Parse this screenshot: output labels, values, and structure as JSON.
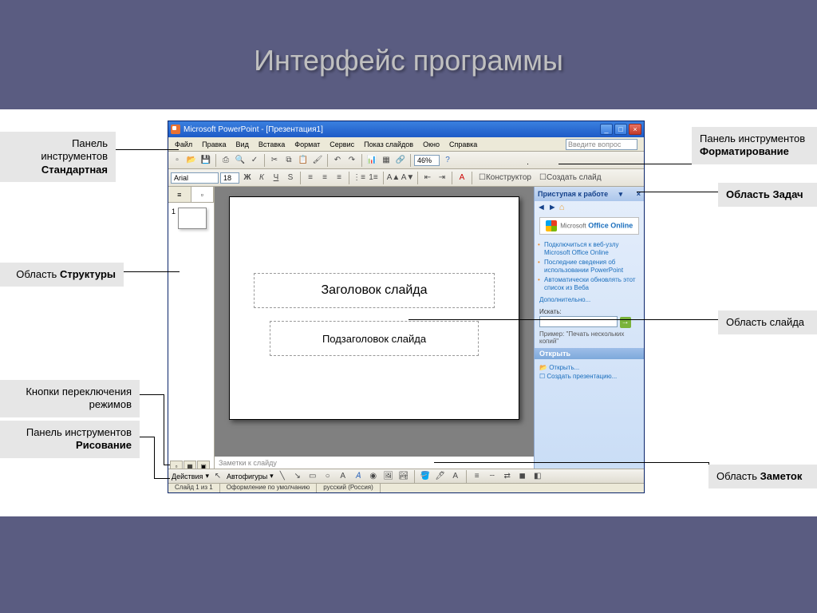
{
  "page_title": "Интерфейс программы",
  "callouts": {
    "standard_toolbar": "Панель инструментов",
    "standard_toolbar_b": "Стандартная",
    "format_toolbar": "Панель инструментов",
    "format_toolbar_b": "Форматирование",
    "task_area": "Область ",
    "task_area_b": "Задач",
    "outline_area": "Область ",
    "outline_area_b": "Структуры",
    "slide_area": "Область слайда",
    "view_btns": "Кнопки переключения режимов",
    "draw_toolbar": "Панель инструментов",
    "draw_toolbar_b": "Рисование",
    "notes_area": "Область ",
    "notes_area_b": "Заметок"
  },
  "app": {
    "title": "Microsoft PowerPoint  - [Презентация1]",
    "menus": [
      "Файл",
      "Правка",
      "Вид",
      "Вставка",
      "Формат",
      "Сервис",
      "Показ слайдов",
      "Окно",
      "Справка"
    ],
    "ask_placeholder": "Введите вопрос",
    "font_name": "Arial",
    "font_size": "18",
    "design_btn": "Конструктор",
    "newslide_btn": "Создать слайд",
    "outline_tabs": [
      "",
      ""
    ],
    "thumb_num": "1",
    "slide_title_ph": "Заголовок слайда",
    "slide_sub_ph": "Подзаголовок слайда",
    "notes_ph": "Заметки к слайду",
    "taskpane": {
      "header": "Приступая к работе",
      "office_online_prefix": "Microsoft",
      "office_online_b": "Office Online",
      "links": [
        "Подключиться к веб-узлу Microsoft Office Online",
        "Последние сведения об использовании PowerPoint",
        "Автоматически обновлять этот список из Веба"
      ],
      "more": "Дополнительно...",
      "search_label": "Искать:",
      "hint": "Пример: \"Печать нескольких копий\"",
      "open_header": "Открыть",
      "open_link": "Открыть...",
      "create_link": "Создать презентацию..."
    },
    "drawbar": {
      "actions": "Действия",
      "autoshapes": "Автофигуры"
    },
    "status": {
      "slide": "Слайд 1 из 1",
      "design": "Оформление по умолчанию",
      "lang": "русский (Россия)"
    }
  }
}
